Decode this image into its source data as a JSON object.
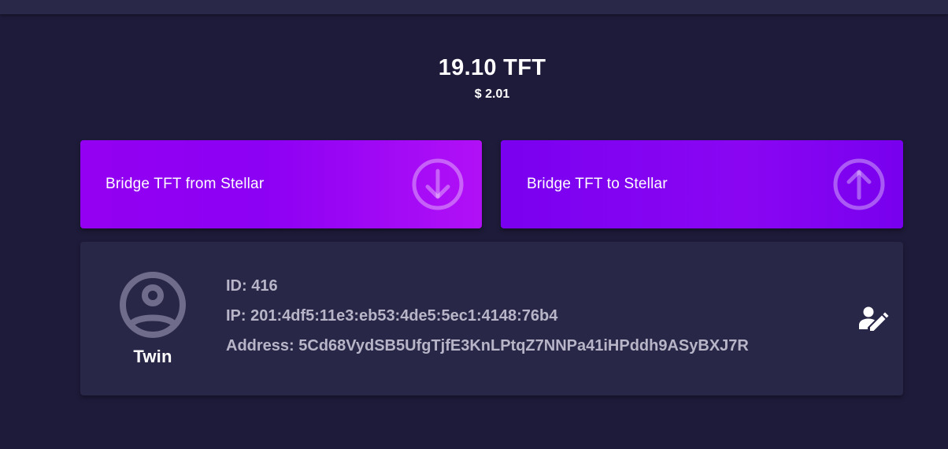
{
  "balance": {
    "amount": "19.10 TFT",
    "usd": "$ 2.01"
  },
  "bridge": {
    "from_label": "Bridge TFT from Stellar",
    "to_label": "Bridge TFT to Stellar"
  },
  "twin": {
    "label": "Twin",
    "id_line": "ID: 416",
    "ip_line": "IP: 201:4df5:11e3:eb53:4de5:5ec1:4148:76b4",
    "address_line": "Address: 5Cd68VydSB5UfgTjfE3KnLPtqZ7NNPa41iHPddh9ASyBXJ7R"
  },
  "icons": {
    "bridge_from": "arrow-down-circle-icon",
    "bridge_to": "arrow-up-circle-icon",
    "twin_avatar": "account-circle-icon",
    "edit_twin": "account-edit-icon"
  },
  "colors": {
    "background": "#1e1b3a",
    "card": "#292747",
    "bridge_from": "#9400f2",
    "bridge_to": "#7a00f0",
    "muted_text": "#b7b5c7"
  }
}
